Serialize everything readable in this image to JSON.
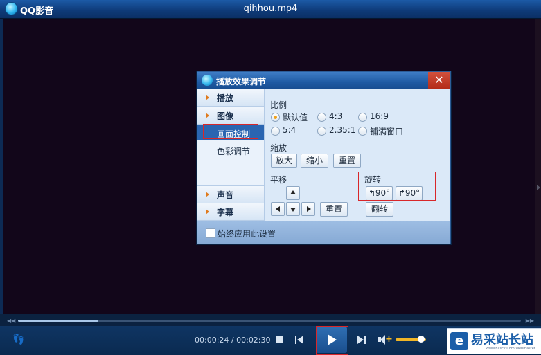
{
  "window": {
    "app_name": "QQ影音",
    "file_title": "qihhou.mp4"
  },
  "dialog": {
    "title": "播放效果调节",
    "close_glyph": "✕",
    "sidebar": {
      "play": "播放",
      "image": "图像",
      "picture_control": "画面控制",
      "color_adjust": "色彩调节",
      "sound": "声音",
      "subtitle": "字幕"
    },
    "ratio": {
      "label": "比例",
      "options": [
        "默认值",
        "4:3",
        "16:9",
        "5:4",
        "2.35:1",
        "铺满窗口"
      ],
      "selected": "默认值"
    },
    "zoom": {
      "label": "缩放",
      "zoom_in": "放大",
      "zoom_out": "缩小",
      "reset": "重置"
    },
    "pan": {
      "label": "平移",
      "reset": "重置"
    },
    "rotate": {
      "label": "旋转",
      "left": "90°",
      "right": "90°",
      "flip": "翻转"
    },
    "footer": {
      "always_apply": "始终应用此设置"
    }
  },
  "player": {
    "time_current": "00:00:24",
    "time_separator": " / ",
    "time_total": "00:02:30",
    "progress": 0.16,
    "volume": 0.85,
    "seek_left_glyph": "◀◀",
    "seek_right_glyph": "▶▶"
  },
  "watermark": {
    "name": "易采站长站",
    "url": "Www.Easck.Com Webmaster"
  },
  "colors": {
    "title_bar": "#0e3a78",
    "dialog_bg": "#dbe9f8",
    "active_item": "#2a65b1",
    "highlight_box": "#d8272a",
    "close_button": "#c23a25",
    "volume_accent": "#f0b526"
  }
}
